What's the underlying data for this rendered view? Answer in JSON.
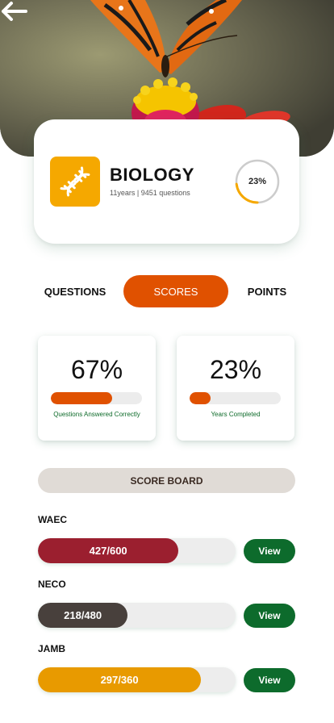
{
  "colors": {
    "accent": "#e05100",
    "subject_icon_bg": "#f5a800",
    "view_button": "#0d6b2c",
    "label_green": "#0e6b2a",
    "ring_progress": "#f5a800",
    "ring_track": "#cccccc"
  },
  "icons": {
    "back": "arrow-left-icon",
    "subject": "dna-icon"
  },
  "subject": {
    "title": "BIOLOGY",
    "meta": "11years | 9451 questions",
    "progress_label": "23%",
    "progress": 0.23
  },
  "tabs": [
    {
      "label": "QUESTIONS",
      "active": false
    },
    {
      "label": "SCORES",
      "active": true
    },
    {
      "label": "POINTS",
      "active": false
    }
  ],
  "stats": [
    {
      "value": "67%",
      "fraction": 0.67,
      "label": "Questions Answered Correctly"
    },
    {
      "value": "23%",
      "fraction": 0.23,
      "label": "Years Completed"
    }
  ],
  "scoreboard": {
    "title": "SCORE BOARD",
    "view_label": "View",
    "exams": [
      {
        "name": "WAEC",
        "score": "427/600",
        "fraction": 0.7117,
        "color": "#9b1f2f"
      },
      {
        "name": "NECO",
        "score": "218/480",
        "fraction": 0.4542,
        "color": "#48403c"
      },
      {
        "name": "JAMB",
        "score": "297/360",
        "fraction": 0.825,
        "color": "#e89a00"
      }
    ]
  }
}
